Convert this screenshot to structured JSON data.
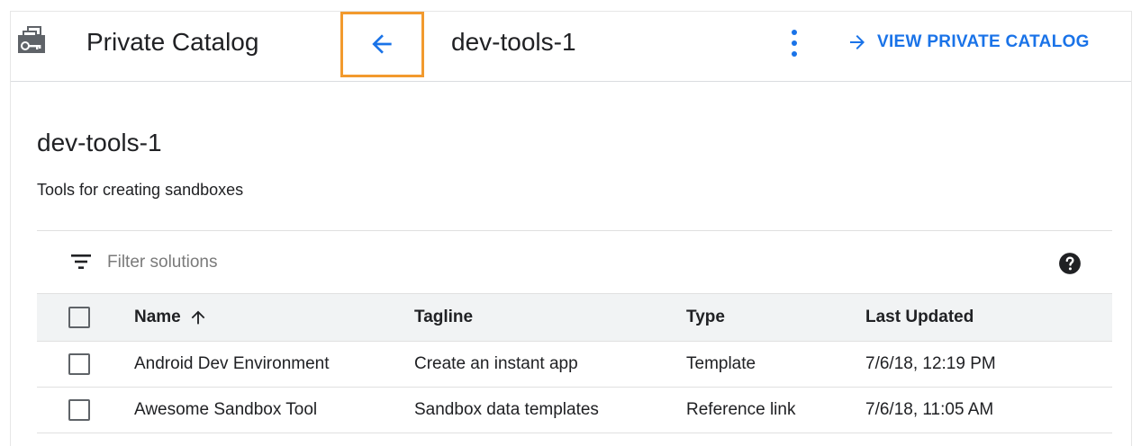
{
  "header": {
    "app_title": "Private Catalog",
    "crumb": "dev-tools-1",
    "view_link": "VIEW PRIVATE CATALOG",
    "icons": {
      "app": "catalog-key-icon",
      "back": "arrow-back-icon",
      "more": "more-vert-icon",
      "link": "arrow-forward-icon"
    }
  },
  "colors": {
    "accent": "#1a73e8",
    "highlight": "#f29a2e",
    "header_row_bg": "#f1f3f4"
  },
  "catalog": {
    "title": "dev-tools-1",
    "description": "Tools for creating sandboxes"
  },
  "filter": {
    "placeholder": "Filter solutions",
    "icons": {
      "filter": "filter-list-icon",
      "help": "help-icon"
    }
  },
  "table": {
    "columns": {
      "name": "Name",
      "tagline": "Tagline",
      "type": "Type",
      "updated": "Last Updated"
    },
    "sort": {
      "column": "Name",
      "direction": "ascending",
      "icon": "arrow-upward-icon"
    },
    "rows": [
      {
        "name": "Android Dev Environment",
        "tagline": "Create an instant app",
        "type": "Template",
        "updated": "7/6/18, 12:19 PM"
      },
      {
        "name": "Awesome Sandbox Tool",
        "tagline": "Sandbox data templates",
        "type": "Reference link",
        "updated": "7/6/18, 11:05 AM"
      }
    ]
  }
}
